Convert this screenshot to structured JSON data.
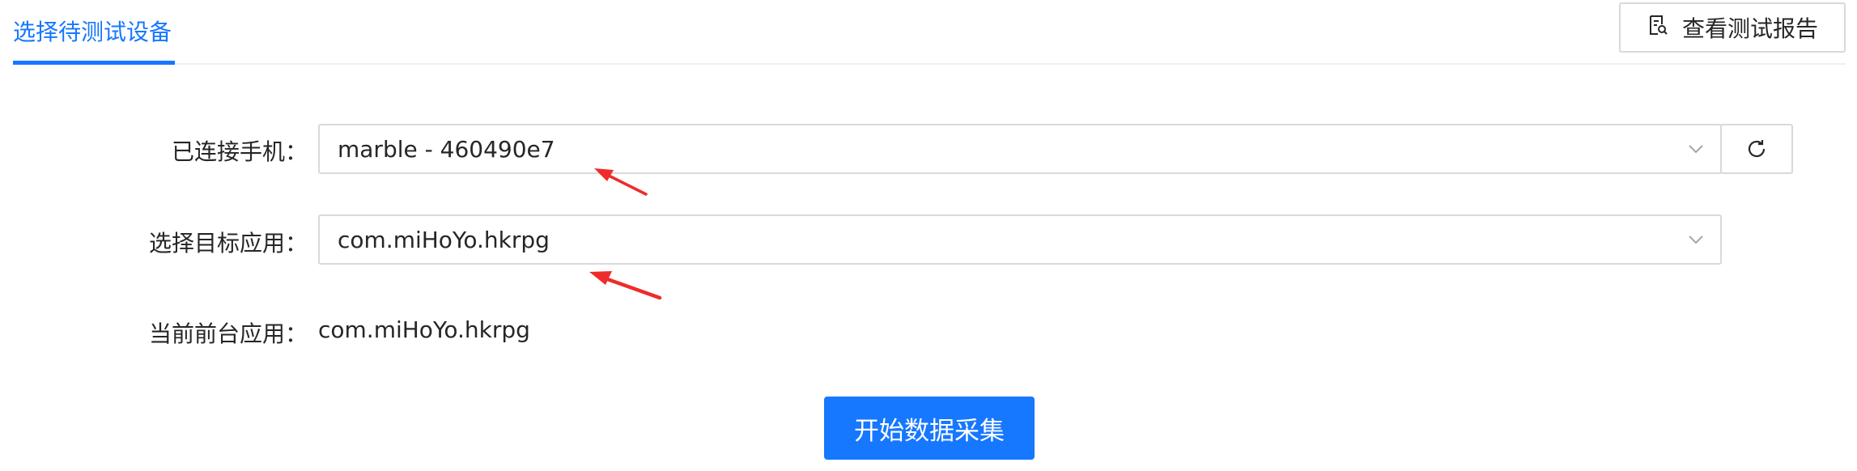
{
  "tabs": {
    "active_label": "选择待测试设备"
  },
  "toolbar": {
    "report_label": "查看测试报告"
  },
  "form": {
    "phone_label": "已连接手机：",
    "phone_value": "marble - 460490e7",
    "app_label": "选择目标应用：",
    "app_value": "com.miHoYo.hkrpg",
    "foreground_label": "当前前台应用：",
    "foreground_value": "com.miHoYo.hkrpg"
  },
  "actions": {
    "start_label": "开始数据采集"
  },
  "colors": {
    "primary": "#1677ff",
    "annotation_arrow": "#ef2b2b",
    "border": "#d9d9d9"
  },
  "icons": [
    "report-icon",
    "chevron-down-icon",
    "refresh-icon",
    "annotation-arrow"
  ]
}
